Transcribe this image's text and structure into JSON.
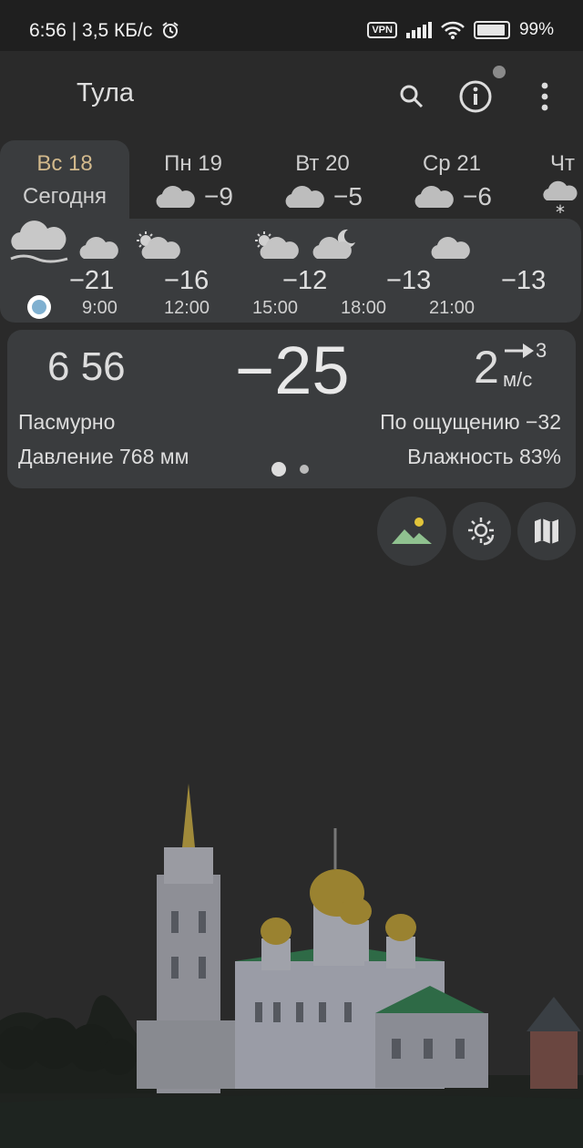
{
  "status": {
    "time": "6:56",
    "speed": "3,5 КБ/с",
    "vpn": "VPN",
    "battery": "99%"
  },
  "app_bar": {
    "city": "Тула",
    "icons": [
      "search-icon",
      "info-icon",
      "more-vert-icon"
    ]
  },
  "days": [
    {
      "name": "Вс 18",
      "label": "Сегодня"
    },
    {
      "name": "Пн 19",
      "temp": "−9",
      "icon": "cloud-icon"
    },
    {
      "name": "Вт 20",
      "temp": "−5",
      "icon": "cloud-icon"
    },
    {
      "name": "Ср 21",
      "temp": "−6",
      "icon": "cloud-icon"
    },
    {
      "name": "Чт",
      "icon": "snow-cloud-icon"
    }
  ],
  "hourly": [
    {
      "temp": "−21",
      "time": "9:00",
      "icon": "cloud-icon"
    },
    {
      "temp": "−16",
      "time": "12:00",
      "icon": "partly-cloudy-day-icon"
    },
    {
      "temp": "−12",
      "time": "15:00",
      "icon": "partly-cloudy-day-icon"
    },
    {
      "temp": "−13",
      "time": "18:00",
      "icon": "partly-cloudy-night-icon"
    },
    {
      "temp": "−13",
      "time": "21:00",
      "icon": "cloud-icon"
    }
  ],
  "current": {
    "time": "6 56",
    "temp": "−25",
    "wind_speed": "2",
    "wind_gust": "3",
    "wind_unit": "м/с",
    "condition": "Пасмурно",
    "pressure": "Давление 768 мм",
    "feels_like": "По ощущению −32",
    "humidity": "Влажность 83%"
  },
  "actions": [
    "landscape-icon",
    "sun-moon-icon",
    "map-icon"
  ],
  "colors": {
    "background": "#2a2a2a",
    "card": "#3a3c3e",
    "active_day": "#d2b98c",
    "now_marker": "#7fb0d0"
  }
}
